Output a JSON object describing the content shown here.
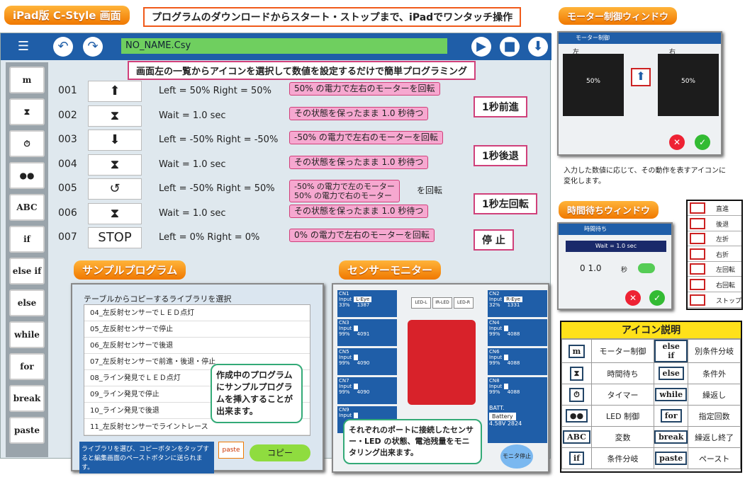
{
  "header": {
    "title_tag": "iPad版 C-Style 画面",
    "banner": "プログラムのダウンロードからスタート・ストップまで、iPadでワンタッチ操作",
    "motor_window_tag": "モーター制御ウィンドウ"
  },
  "app": {
    "filename": "NO_NAME.Csy",
    "menu_icon": "menu-icon",
    "undo_icon": "undo-icon",
    "redo_icon": "redo-icon",
    "play_icon": "play-icon",
    "stop_icon": "stop-icon",
    "download_icon": "download-icon",
    "callout": "画面左の一覧からアイコンを選択して数値を設定するだけで簡単プログラミング"
  },
  "sidebar": [
    "m",
    "⧗",
    "⏱",
    "●●",
    "ABC",
    "if",
    "else if",
    "else",
    "while",
    "for",
    "break",
    "paste"
  ],
  "program": [
    {
      "num": "001",
      "icon": "⬆",
      "text": "Left = 50%   Right = 50%",
      "note": "50% の電力で左右のモーターを回転"
    },
    {
      "num": "002",
      "icon": "⧗",
      "text": "Wait = 1.0 sec",
      "note": "その状態を保ったまま 1.0 秒待つ"
    },
    {
      "num": "003",
      "icon": "⬇",
      "text": "Left = -50%   Right = -50%",
      "note": "-50% の電力で左右のモーターを回転"
    },
    {
      "num": "004",
      "icon": "⧗",
      "text": "Wait = 1.0 sec",
      "note": "その状態を保ったまま 1.0 秒待つ"
    },
    {
      "num": "005",
      "icon": "↺",
      "text": "Left = -50%   Right = 50%",
      "note": "-50% の電力で左のモーター\n50% の電力で右のモーター"
    },
    {
      "num": "006",
      "icon": "⧗",
      "text": "Wait = 1.0 sec",
      "note": "その状態を保ったまま 1.0 秒待つ"
    },
    {
      "num": "007",
      "icon": "STOP",
      "text": "Left = 0%   Right = 0%",
      "note": "0% の電力で左右のモーターを回転"
    }
  ],
  "rotate_suffix": "を回転",
  "brackets": [
    "1秒前進",
    "1秒後退",
    "1秒左回転",
    "停 止"
  ],
  "sample": {
    "tag": "サンプルプログラム",
    "heading": "テーブルからコピーするライブラリを選択",
    "items": [
      "04_左反射センサーでＬＥＤ点灯",
      "05_左反射センサーで停止",
      "06_左反射センサーで後退",
      "07_左反射センサーで前進・後退・停止",
      "08_ライン発見でＬＥＤ点灯",
      "09_ライン発見で停止",
      "10_ライン発見で後退",
      "11_左反射センサーでライントレース"
    ],
    "bubble": "作成中のプログラムにサンプルプログラムを挿入することが出来ます。",
    "footer": "ライブラリを選び、コピーボタンをタップすると編集画面のペーストボタンに送られます。",
    "paste": "paste",
    "copy": "コピー"
  },
  "sensor": {
    "tag": "センサーモニター",
    "leds": [
      "LED-L",
      "IR-LED",
      "LED-R"
    ],
    "left_ports": [
      {
        "cn": "CN1",
        "type": "Input",
        "name": "L-Eye",
        "p": "33%",
        "v": "1387"
      },
      {
        "cn": "CN3",
        "type": "Input",
        "name": "",
        "p": "99%",
        "v": "4091"
      },
      {
        "cn": "CN5",
        "type": "Input",
        "name": "",
        "p": "99%",
        "v": "4090"
      },
      {
        "cn": "CN7",
        "type": "Input",
        "name": "",
        "p": "99%",
        "v": "4090"
      },
      {
        "cn": "CN9",
        "type": "Input",
        "name": "",
        "p": "",
        "v": ""
      }
    ],
    "right_ports": [
      {
        "cn": "CN2",
        "type": "Input",
        "name": "R-Eye",
        "p": "32%",
        "v": "1331"
      },
      {
        "cn": "CN4",
        "type": "Input",
        "name": "",
        "p": "99%",
        "v": "4088"
      },
      {
        "cn": "CN6",
        "type": "Input",
        "name": "",
        "p": "99%",
        "v": "4088"
      },
      {
        "cn": "CN8",
        "type": "Input",
        "name": "",
        "p": "99%",
        "v": "4088"
      }
    ],
    "battery": {
      "label": "BATT.",
      "name": "Battery",
      "volt": "4.58V",
      "v": "2824"
    },
    "bubble": "それぞれのポートに接続したセンサー・LED の状態、電池残量をモニタリング出来ます。",
    "stop": "モニタ停止"
  },
  "motor_window": {
    "title": "モーター制御",
    "left": "左",
    "right": "右",
    "left_val": "50%",
    "right_val": "50%",
    "note": "入力した数値に応じて、その動作を表すアイコンに変化します。"
  },
  "wait_window": {
    "tag": "時間待ちウィンドウ",
    "title": "時間待ち",
    "value_line": "Wait = 1.0 sec",
    "digits": "0 1.0",
    "unit": "秒"
  },
  "direction_list": [
    "直進",
    "後退",
    "左折",
    "右折",
    "左回転",
    "右回転",
    "ストップ"
  ],
  "legend": {
    "title": "アイコン説明",
    "rows": [
      {
        "i1": "m",
        "l1": "モーター制御",
        "i2": "else if",
        "l2": "別条件分岐"
      },
      {
        "i1": "⧗",
        "l1": "時間待ち",
        "i2": "else",
        "l2": "条件外"
      },
      {
        "i1": "⏱",
        "l1": "タイマー",
        "i2": "while",
        "l2": "繰返し"
      },
      {
        "i1": "●●",
        "l1": "LED 制御",
        "i2": "for",
        "l2": "指定回数"
      },
      {
        "i1": "ABC",
        "l1": "変数",
        "i2": "break",
        "l2": "繰返し終了"
      },
      {
        "i1": "if",
        "l1": "条件分岐",
        "i2": "paste",
        "l2": "ペースト"
      }
    ]
  },
  "colors": {
    "accent": "#1f5ea8",
    "orange": "#f07800",
    "pink": "#f6a8d0"
  }
}
